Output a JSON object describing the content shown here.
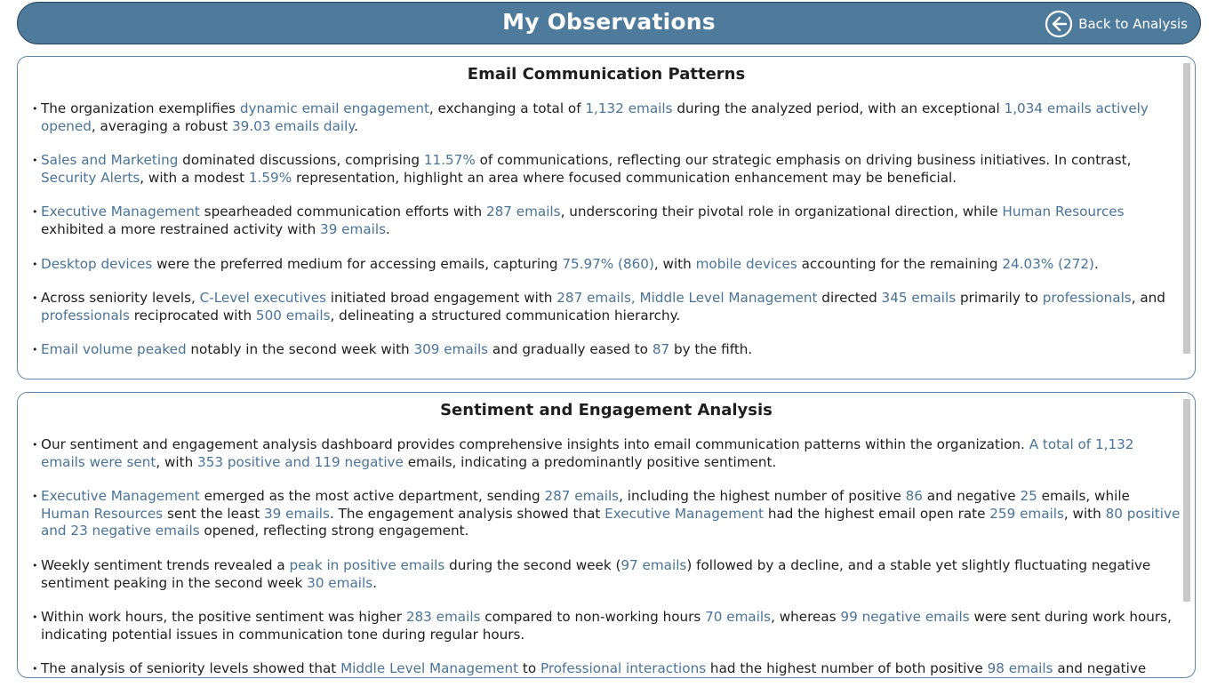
{
  "header": {
    "title": "My Observations",
    "back_label": "Back to Analysis"
  },
  "panels": [
    {
      "title": "Email Communication Patterns",
      "items": [
        [
          [
            "t",
            "The organization exemplifies "
          ],
          [
            "h",
            "dynamic email engagement"
          ],
          [
            "t",
            ", exchanging a total of "
          ],
          [
            "h",
            "1,132 emails"
          ],
          [
            "t",
            " during the analyzed period, with an exceptional "
          ],
          [
            "h",
            "1,034 emails actively opened"
          ],
          [
            "t",
            ", averaging a robust "
          ],
          [
            "h",
            "39.03 emails daily"
          ],
          [
            "t",
            "."
          ]
        ],
        [
          [
            "h",
            "Sales and Marketing"
          ],
          [
            "t",
            " dominated discussions, comprising "
          ],
          [
            "h",
            "11.57%"
          ],
          [
            "t",
            " of communications, reflecting our strategic emphasis on driving business initiatives. In contrast, "
          ],
          [
            "h",
            "Security Alerts"
          ],
          [
            "t",
            ", with a modest "
          ],
          [
            "h",
            "1.59%"
          ],
          [
            "t",
            " representation, highlight an area where focused communication enhancement may be beneficial."
          ]
        ],
        [
          [
            "h",
            "Executive Management"
          ],
          [
            "t",
            " spearheaded communication efforts with "
          ],
          [
            "h",
            "287 emails"
          ],
          [
            "t",
            ", underscoring their pivotal role in organizational direction, while "
          ],
          [
            "h",
            "Human Resources"
          ],
          [
            "t",
            " exhibited a more restrained activity with "
          ],
          [
            "h",
            "39 emails"
          ],
          [
            "t",
            "."
          ]
        ],
        [
          [
            "h",
            "Desktop devices"
          ],
          [
            "t",
            " were the preferred medium for accessing emails, capturing "
          ],
          [
            "h",
            "75.97% (860)"
          ],
          [
            "t",
            ", with "
          ],
          [
            "h",
            "mobile devices"
          ],
          [
            "t",
            " accounting for the remaining "
          ],
          [
            "h",
            "24.03% (272)"
          ],
          [
            "t",
            "."
          ]
        ],
        [
          [
            "t",
            "Across seniority levels, "
          ],
          [
            "h",
            "C-Level executives"
          ],
          [
            "t",
            " initiated broad engagement with "
          ],
          [
            "h",
            "287 emails, Middle Level Management"
          ],
          [
            "t",
            " directed "
          ],
          [
            "h",
            "345 emails"
          ],
          [
            "t",
            " primarily to "
          ],
          [
            "h",
            "professionals"
          ],
          [
            "t",
            ", and "
          ],
          [
            "h",
            "professionals"
          ],
          [
            "t",
            " reciprocated with "
          ],
          [
            "h",
            "500 emails"
          ],
          [
            "t",
            ", delineating a structured communication hierarchy."
          ]
        ],
        [
          [
            "h",
            "Email volume peaked"
          ],
          [
            "t",
            " notably in the second week with "
          ],
          [
            "h",
            "309 emails"
          ],
          [
            "t",
            " and gradually eased to "
          ],
          [
            "h",
            "87"
          ],
          [
            "t",
            " by the fifth."
          ]
        ]
      ]
    },
    {
      "title": "Sentiment and Engagement Analysis",
      "items": [
        [
          [
            "t",
            "Our sentiment and engagement analysis dashboard provides comprehensive insights into email communication patterns within the organization. "
          ],
          [
            "h",
            "A total of 1,132 emails were sent"
          ],
          [
            "t",
            ", with "
          ],
          [
            "h",
            "353 positive and 119 negative"
          ],
          [
            "t",
            " emails, indicating a predominantly positive sentiment."
          ]
        ],
        [
          [
            "h",
            "Executive Management"
          ],
          [
            "t",
            " emerged as the most active department, sending "
          ],
          [
            "h",
            "287 emails"
          ],
          [
            "t",
            ", including the highest number of positive "
          ],
          [
            "h",
            "86"
          ],
          [
            "t",
            " and negative "
          ],
          [
            "h",
            "25"
          ],
          [
            "t",
            " emails, while "
          ],
          [
            "h",
            "Human Resources"
          ],
          [
            "t",
            " sent the least "
          ],
          [
            "h",
            "39 emails"
          ],
          [
            "t",
            ". The engagement analysis showed that "
          ],
          [
            "h",
            "Executive Management"
          ],
          [
            "t",
            " had the highest email open rate "
          ],
          [
            "h",
            "259 emails"
          ],
          [
            "t",
            ", with "
          ],
          [
            "h",
            "80 positive and 23 negative emails"
          ],
          [
            "t",
            " opened, reflecting strong engagement."
          ]
        ],
        [
          [
            "t",
            "Weekly sentiment trends revealed a "
          ],
          [
            "h",
            "peak in positive emails"
          ],
          [
            "t",
            " during the second week ("
          ],
          [
            "h",
            "97 emails"
          ],
          [
            "t",
            ") followed by a decline, and a stable yet slightly fluctuating negative sentiment peaking in the second week "
          ],
          [
            "h",
            "30 emails"
          ],
          [
            "t",
            "."
          ]
        ],
        [
          [
            "t",
            "Within work hours, the positive sentiment was higher "
          ],
          [
            "h",
            "283 emails"
          ],
          [
            "t",
            " compared to non-working hours "
          ],
          [
            "h",
            "70 emails"
          ],
          [
            "t",
            ", whereas "
          ],
          [
            "h",
            "99 negative emails"
          ],
          [
            "t",
            " were sent during work hours, indicating potential issues in communication tone during regular hours."
          ]
        ],
        [
          [
            "t",
            "The analysis of seniority levels showed that "
          ],
          [
            "h",
            "Middle Level Management"
          ],
          [
            "t",
            " to "
          ],
          [
            "h",
            "Professional interactions"
          ],
          [
            "t",
            " had the highest number of both positive "
          ],
          [
            "h",
            "98 emails"
          ],
          [
            "t",
            " and negative"
          ]
        ]
      ]
    }
  ]
}
